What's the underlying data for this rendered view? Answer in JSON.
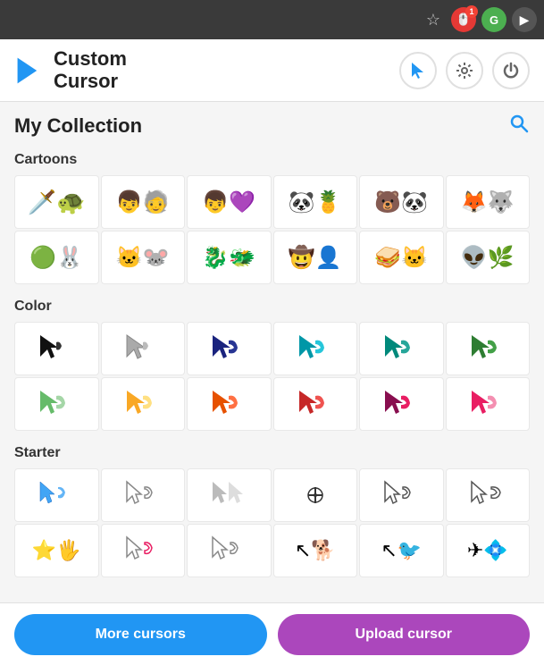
{
  "browser": {
    "star_label": "☆",
    "ext1_label": "1",
    "ext2_label": "G",
    "ext3_label": "▶"
  },
  "header": {
    "logo_line1": "Custom",
    "logo_line2": "Cursor",
    "btn_cursor_label": "↖",
    "btn_settings_label": "⚙",
    "btn_power_label": "⏻"
  },
  "collection": {
    "title": "My Collection",
    "search_label": "🔍"
  },
  "categories": [
    {
      "name": "Cartoons",
      "id": "cartoons",
      "rows": [
        [
          "🗡️🐢",
          "👦🧓",
          "👦💜",
          "🐼🍍",
          "🐻🐼",
          "🦊🐺"
        ],
        [
          "🟢🐰",
          "🐱🐭",
          "🐉🐲",
          "🤠👤",
          "🥪🐱",
          "👽🌿"
        ]
      ]
    },
    {
      "name": "Color",
      "id": "color",
      "rows": [
        [
          "▶🖐️",
          "▷🖐",
          "▶🖐",
          "▶🖐",
          "▶🖐",
          "▶🖐"
        ],
        [
          "▶🖐",
          "▶🖐",
          "▶🖐",
          "▶🖐",
          "▶🖐",
          "▶🖐"
        ]
      ]
    },
    {
      "name": "Starter",
      "id": "starter",
      "rows": [
        [
          "↖🖐",
          "↖🖐",
          "▶▶",
          "⊕⊕",
          "↖🖐",
          "↖🖐"
        ],
        [
          "⭐🖐",
          "↖🖐",
          "↖🖐",
          "↖🐕",
          "↖🐦",
          "✈💠"
        ]
      ]
    }
  ],
  "buttons": {
    "more_cursors": "More cursors",
    "upload_cursor": "Upload cursor"
  }
}
